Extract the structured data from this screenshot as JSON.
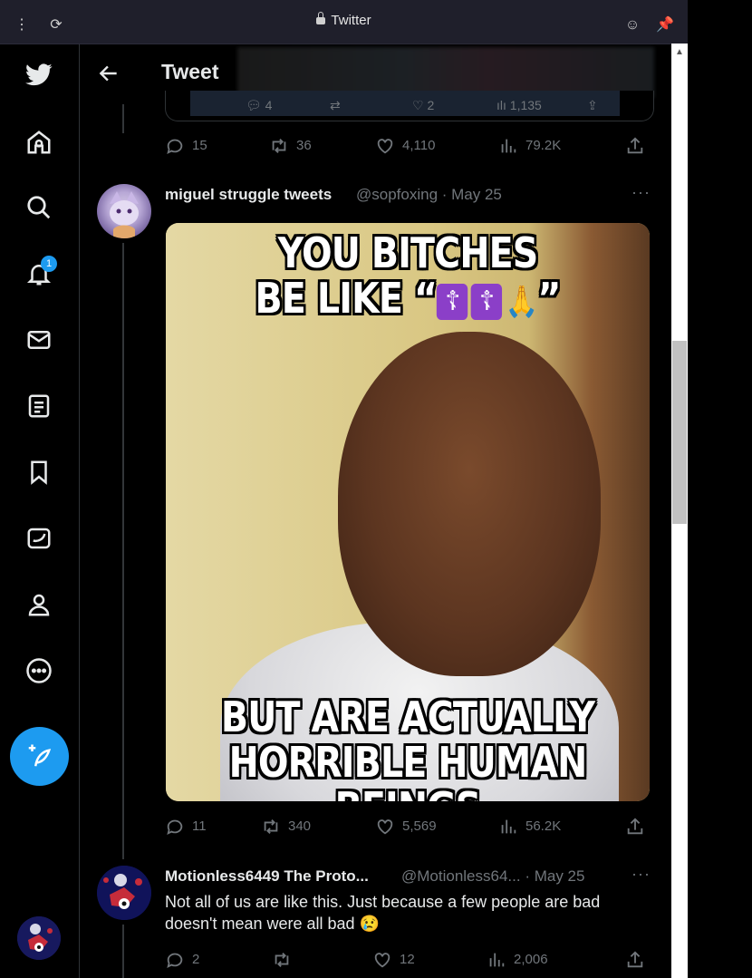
{
  "window": {
    "title": "Twitter"
  },
  "header": {
    "title": "Tweet"
  },
  "nav": {
    "notification_count": "1"
  },
  "quoted_stats": {
    "replies": "4",
    "likes": "2",
    "views": "1,135"
  },
  "tweet0": {
    "replies": "15",
    "retweets": "36",
    "likes": "4,110",
    "views": "79.2K"
  },
  "tweet1": {
    "name": "miguel struggle tweets",
    "handle": "@sopfoxing · May 25",
    "meme_top_line1": "YOU BITCHES",
    "meme_top_line2": "BE LIKE “",
    "meme_top_close": "”",
    "meme_bottom_line1": "BUT ARE ACTUALLY",
    "meme_bottom_line2": "HORRIBLE HUMAN BEINGS",
    "replies": "11",
    "retweets": "340",
    "likes": "5,569",
    "views": "56.2K"
  },
  "tweet2": {
    "name": "Motionless6449 The Proto...",
    "handle": "@Motionless64... · May 25",
    "text_line1": "Not all of us are like this. Just because a few people are bad",
    "text_line2": "doesn't mean were all bad",
    "emoji": "😢",
    "replies": "2",
    "likes": "12",
    "views": "2,006"
  }
}
